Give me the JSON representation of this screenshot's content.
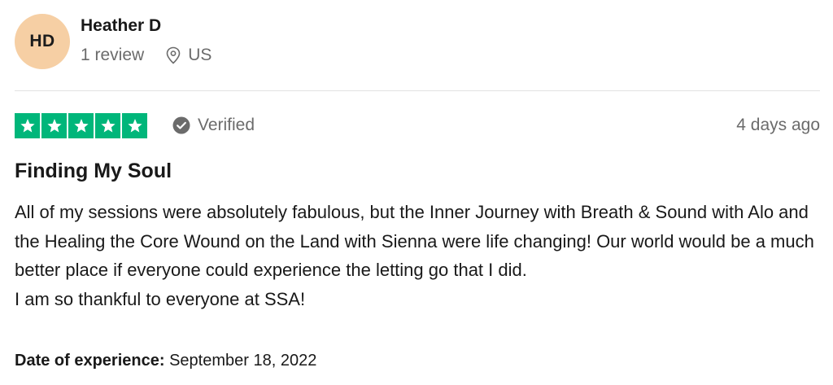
{
  "reviewer": {
    "initials": "HD",
    "name": "Heather D",
    "review_count": "1 review",
    "location": "US",
    "avatar_color": "#f6cfa4"
  },
  "rating": {
    "stars": 5,
    "max_stars": 5,
    "star_color": "#00b67a",
    "icon": "star-icon"
  },
  "verified": {
    "label": "Verified",
    "icon": "check-circle-icon"
  },
  "posted": "4 days ago",
  "review": {
    "title": "Finding My Soul",
    "paragraph_1": "All of my sessions were absolutely fabulous, but the Inner Journey with Breath & Sound with Alo and the Healing the Core Wound on the Land with Sienna were life changing! Our world would be a much better place if everyone could experience the letting go that I did.",
    "paragraph_2": "I am so thankful to everyone at SSA!"
  },
  "experience": {
    "label": "Date of experience:",
    "date": "September 18, 2022"
  }
}
